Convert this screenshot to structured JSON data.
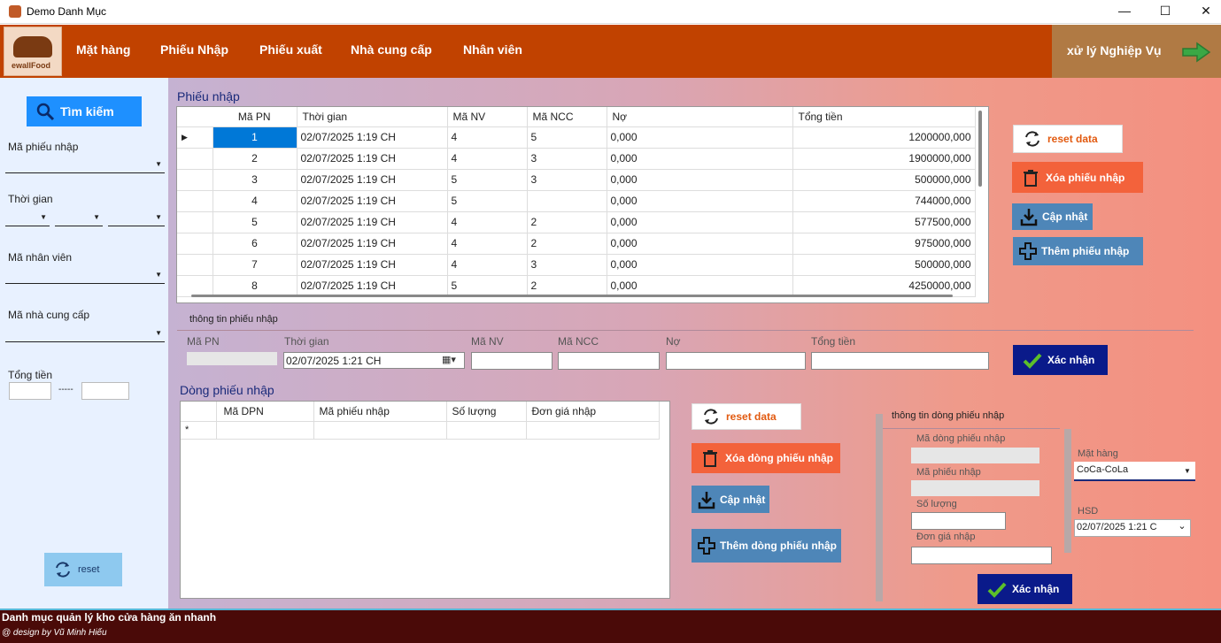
{
  "window": {
    "title": "Demo Danh Mục",
    "minimize": "—",
    "maximize": "☐",
    "close": "✕"
  },
  "logo": {
    "text": "ewallFood"
  },
  "menu": {
    "items": [
      "Mặt hàng",
      "Phiếu Nhập",
      "Phiếu xuất",
      "Nhà cung cấp",
      "Nhân viên"
    ],
    "business": "xử lý Nghiệp Vụ"
  },
  "left": {
    "search_label": "Tìm kiếm",
    "ma_phieu_nhap": "Mã phiếu nhập",
    "thoi_gian": "Thời gian",
    "ma_nhan_vien": "Mã nhân viên",
    "ma_ncc": "Mã nhà cung cấp",
    "tong_tien": "Tổng tiền",
    "dash": "-----",
    "reset": "reset"
  },
  "phieu_nhap": {
    "title": "Phiếu nhập",
    "columns": [
      "Mã PN",
      "Thời gian",
      "Mã NV",
      "Mã NCC",
      "Nợ",
      "Tổng tiền"
    ],
    "rows": [
      [
        "1",
        "02/07/2025 1:19 CH",
        "4",
        "5",
        "0,000",
        "1200000,000"
      ],
      [
        "2",
        "02/07/2025 1:19 CH",
        "4",
        "3",
        "0,000",
        "1900000,000"
      ],
      [
        "3",
        "02/07/2025 1:19 CH",
        "5",
        "3",
        "0,000",
        "500000,000"
      ],
      [
        "4",
        "02/07/2025 1:19 CH",
        "5",
        "",
        "0,000",
        "744000,000"
      ],
      [
        "5",
        "02/07/2025 1:19 CH",
        "4",
        "2",
        "0,000",
        "577500,000"
      ],
      [
        "6",
        "02/07/2025 1:19 CH",
        "4",
        "2",
        "0,000",
        "975000,000"
      ],
      [
        "7",
        "02/07/2025 1:19 CH",
        "4",
        "3",
        "0,000",
        "500000,000"
      ],
      [
        "8",
        "02/07/2025 1:19 CH",
        "5",
        "2",
        "0,000",
        "4250000,000"
      ]
    ],
    "current_marker": "▶"
  },
  "right_buttons": {
    "reset": "reset data",
    "delete": "Xóa phiếu nhập",
    "update": "Cập nhật",
    "add": "Thêm phiếu nhập"
  },
  "thong_tin": {
    "title": "thông tin phiếu nhập",
    "labels": [
      "Mã PN",
      "Thời gian",
      "Mã NV",
      "Mã NCC",
      "Nợ",
      "Tổng tiền"
    ],
    "date_value": "02/07/2025   1:21 CH",
    "confirm": "Xác nhận"
  },
  "dong_phieu": {
    "title": "Dòng phiếu nhập",
    "columns": [
      "Mã DPN",
      "Mã phiếu nhập",
      "Số lượng",
      "Đơn giá nhập"
    ],
    "new_row_marker": "*"
  },
  "dong_buttons": {
    "reset": "reset data",
    "delete": "Xóa dòng phiếu nhập",
    "update": "Cập nhật",
    "add": "Thêm dòng phiếu nhập"
  },
  "thong_tin_dong": {
    "title": "thông tin dòng phiếu nhập",
    "labels": [
      "Mã dòng phiếu nhập",
      "Mã phiếu nhập",
      "Số lượng",
      "Đơn giá nhập"
    ],
    "mat_hang_label": "Mặt hàng",
    "mat_hang_value": "CoCa-CoLa",
    "hsd_label": "HSD",
    "hsd_value": "02/07/2025   1:21 C",
    "confirm": "Xác nhận"
  },
  "footer": {
    "line1": "Danh mục quản lý kho cửa hàng ăn nhanh",
    "line2": "@ design by Vũ Minh Hiếu"
  }
}
